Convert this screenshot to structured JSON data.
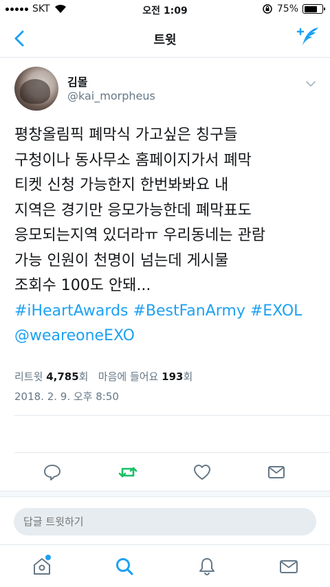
{
  "status": {
    "carrier": "SKT",
    "time": "오전 1:09",
    "battery_text": "75%",
    "battery_level": 0.75
  },
  "nav": {
    "title": "트윗"
  },
  "tweet": {
    "display_name": "김몰",
    "handle": "@kai_morpheus",
    "lines": [
      "평창올림픽 폐막식 가고싶은 칭구들",
      "구청이나 동사무소 홈페이지가서 폐막",
      "티켓 신청 가능한지 한번봐봐요 내",
      "지역은 경기만 응모가능한데 폐막표도",
      "응모되는지역 있더라ㅠ 우리동네는 관람",
      "가능 인원이 천명이 넘는데 게시물",
      "조회수 100도 안돼..."
    ],
    "hashtags_line": "#iHeartAwards #BestFanArmy #EXOL",
    "mention_line": "@weareoneEXO",
    "timestamp": "2018. 2. 9. 오후 8:50",
    "retweets_label": "리트윗",
    "retweets_count": "4,785",
    "retweets_unit": "회",
    "likes_label": "마음에 들어요",
    "likes_count": "193",
    "likes_unit": "회"
  },
  "reply": {
    "placeholder": "답글 트윗하기"
  },
  "colors": {
    "accent": "#1da1f2",
    "retweet_green": "#17bf63",
    "secondary_text": "#657786",
    "divider": "#e1e8ed"
  },
  "icons": {
    "back": "chevron-left-icon",
    "compose": "compose-tweet-icon",
    "caret": "chevron-down-icon",
    "reply": "reply-icon",
    "retweet": "retweet-icon",
    "like": "heart-icon",
    "dm": "envelope-icon",
    "home": "home-icon",
    "search": "search-icon",
    "notifications": "bell-icon",
    "messages": "envelope-icon"
  }
}
